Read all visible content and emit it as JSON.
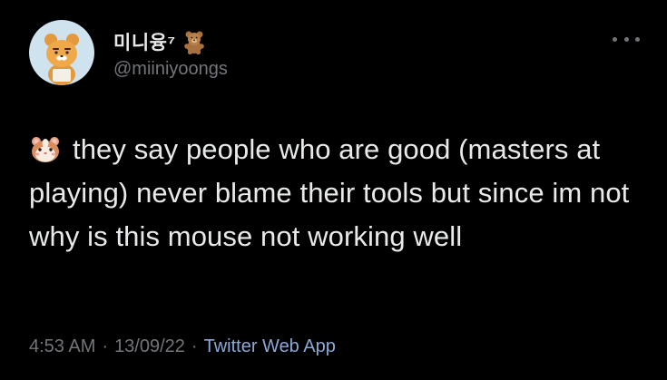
{
  "author": {
    "display_name": "미니융⁷",
    "handle": "@miiniyoongs",
    "avatar_icon": "ryan-bear-icon",
    "name_emoji": "teddy-bear-icon"
  },
  "tweet": {
    "emoji": "hamster-icon",
    "text": "they say people who are good (masters at playing) never blame their tools but since im not why is this mouse not working well"
  },
  "meta": {
    "time": "4:53 AM",
    "separator": "·",
    "date": "13/09/22",
    "source": "Twitter Web App"
  },
  "colors": {
    "background": "#000000",
    "text": "#e7e9ea",
    "secondary": "#71767b",
    "link": "#8aa9d6"
  }
}
